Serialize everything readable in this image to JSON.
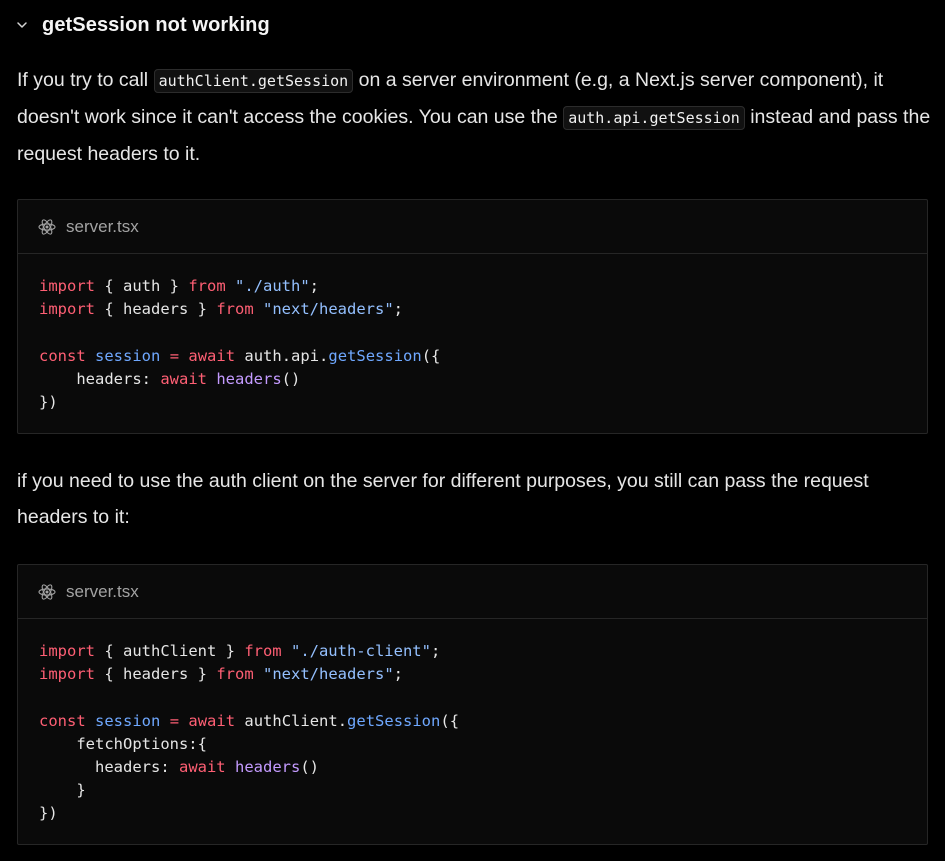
{
  "section": {
    "title": "getSession not working"
  },
  "para1": {
    "t1": "If you try to call ",
    "code1": "authClient.getSession",
    "t2": " on a server environment (e.g, a Next.js server component), it doesn't work since it can't access the cookies. You can use the ",
    "code2": "auth.api.getSession",
    "t3": " instead and pass the request headers to it."
  },
  "para2": {
    "text": "if you need to use the auth client on the server for different purposes, you still can pass the request headers to it:"
  },
  "code1": {
    "filename": "server.tsx",
    "lines": [
      [
        {
          "t": "import",
          "c": "kw"
        },
        {
          "t": " { auth } ",
          "c": "pl"
        },
        {
          "t": "from",
          "c": "kw"
        },
        {
          "t": " ",
          "c": "pl"
        },
        {
          "t": "\"./auth\"",
          "c": "str"
        },
        {
          "t": ";",
          "c": "pl"
        }
      ],
      [
        {
          "t": "import",
          "c": "kw"
        },
        {
          "t": " { headers } ",
          "c": "pl"
        },
        {
          "t": "from",
          "c": "kw"
        },
        {
          "t": " ",
          "c": "pl"
        },
        {
          "t": "\"next/headers\"",
          "c": "str"
        },
        {
          "t": ";",
          "c": "pl"
        }
      ],
      [],
      [
        {
          "t": "const",
          "c": "kw"
        },
        {
          "t": " ",
          "c": "pl"
        },
        {
          "t": "session",
          "c": "var"
        },
        {
          "t": " ",
          "c": "pl"
        },
        {
          "t": "=",
          "c": "kw"
        },
        {
          "t": " ",
          "c": "pl"
        },
        {
          "t": "await",
          "c": "kw"
        },
        {
          "t": " auth.api.",
          "c": "pl"
        },
        {
          "t": "getSession",
          "c": "var"
        },
        {
          "t": "({",
          "c": "pl"
        }
      ],
      [
        {
          "t": "    headers: ",
          "c": "pl"
        },
        {
          "t": "await",
          "c": "kw"
        },
        {
          "t": " ",
          "c": "pl"
        },
        {
          "t": "headers",
          "c": "fn"
        },
        {
          "t": "()",
          "c": "pl"
        }
      ],
      [
        {
          "t": "})",
          "c": "pl"
        }
      ]
    ]
  },
  "code2": {
    "filename": "server.tsx",
    "lines": [
      [
        {
          "t": "import",
          "c": "kw"
        },
        {
          "t": " { authClient } ",
          "c": "pl"
        },
        {
          "t": "from",
          "c": "kw"
        },
        {
          "t": " ",
          "c": "pl"
        },
        {
          "t": "\"./auth-client\"",
          "c": "str"
        },
        {
          "t": ";",
          "c": "pl"
        }
      ],
      [
        {
          "t": "import",
          "c": "kw"
        },
        {
          "t": " { headers } ",
          "c": "pl"
        },
        {
          "t": "from",
          "c": "kw"
        },
        {
          "t": " ",
          "c": "pl"
        },
        {
          "t": "\"next/headers\"",
          "c": "str"
        },
        {
          "t": ";",
          "c": "pl"
        }
      ],
      [],
      [
        {
          "t": "const",
          "c": "kw"
        },
        {
          "t": " ",
          "c": "pl"
        },
        {
          "t": "session",
          "c": "var"
        },
        {
          "t": " ",
          "c": "pl"
        },
        {
          "t": "=",
          "c": "kw"
        },
        {
          "t": " ",
          "c": "pl"
        },
        {
          "t": "await",
          "c": "kw"
        },
        {
          "t": " authClient.",
          "c": "pl"
        },
        {
          "t": "getSession",
          "c": "var"
        },
        {
          "t": "({",
          "c": "pl"
        }
      ],
      [
        {
          "t": "    fetchOptions:{",
          "c": "pl"
        }
      ],
      [
        {
          "t": "      headers: ",
          "c": "pl"
        },
        {
          "t": "await",
          "c": "kw"
        },
        {
          "t": " ",
          "c": "pl"
        },
        {
          "t": "headers",
          "c": "fn"
        },
        {
          "t": "()",
          "c": "pl"
        }
      ],
      [
        {
          "t": "    }",
          "c": "pl"
        }
      ],
      [
        {
          "t": "})",
          "c": "pl"
        }
      ]
    ]
  },
  "icons": {
    "chevron": "chevron-down-icon",
    "file": "react-icon"
  },
  "colors": {
    "background": "#000000",
    "keyword": "#ff5f74",
    "string": "#94c0ff",
    "identifier": "#6fa8ff",
    "function": "#c49bff",
    "text": "#e6e6e6"
  }
}
